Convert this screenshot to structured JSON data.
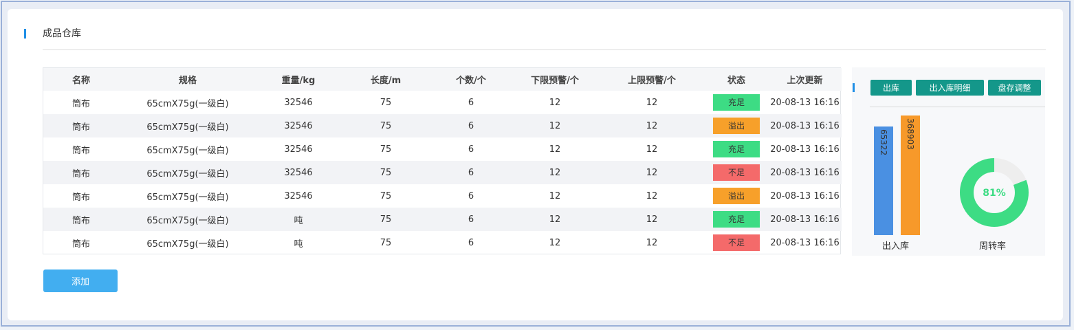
{
  "page": {
    "title": "成品仓库"
  },
  "table": {
    "headers": [
      "名称",
      "规格",
      "重量/kg",
      "长度/m",
      "个数/个",
      "下限预警/个",
      "上限预警/个",
      "状态",
      "上次更新"
    ],
    "rows": [
      [
        "筒布",
        "65cmX75g(一级白)",
        "32546",
        "75",
        "6",
        "12",
        "12",
        "充足",
        "20-08-13 16:16"
      ],
      [
        "筒布",
        "65cmX75g(一级白)",
        "32546",
        "75",
        "6",
        "12",
        "12",
        "溢出",
        "20-08-13 16:16"
      ],
      [
        "筒布",
        "65cmX75g(一级白)",
        "32546",
        "75",
        "6",
        "12",
        "12",
        "充足",
        "20-08-13 16:16"
      ],
      [
        "筒布",
        "65cmX75g(一级白)",
        "32546",
        "75",
        "6",
        "12",
        "12",
        "不足",
        "20-08-13 16:16"
      ],
      [
        "筒布",
        "65cmX75g(一级白)",
        "32546",
        "75",
        "6",
        "12",
        "12",
        "溢出",
        "20-08-13 16:16"
      ],
      [
        "筒布",
        "65cmX75g(一级白)",
        "吨",
        "75",
        "6",
        "12",
        "12",
        "充足",
        "20-08-13 16:16"
      ],
      [
        "筒布",
        "65cmX75g(一级白)",
        "吨",
        "75",
        "6",
        "12",
        "12",
        "不足",
        "20-08-13 16:16"
      ]
    ],
    "status_colors": {
      "充足": "#3ddc84",
      "溢出": "#f7a02a",
      "不足": "#f46a6a"
    }
  },
  "actions": {
    "add_label": "添加"
  },
  "side_panel": {
    "buttons": [
      "出库",
      "出入库明细",
      "盘存调整"
    ],
    "button_color": "#14978a"
  },
  "chart_data": [
    {
      "type": "bar",
      "categories": [
        "出入库"
      ],
      "series": [
        {
          "values": [
            65322
          ],
          "color": "#4a90e2"
        },
        {
          "values": [
            368903
          ],
          "color": "#f7992a"
        }
      ],
      "xlabel": "出入库"
    },
    {
      "type": "pie",
      "values": [
        81,
        19
      ],
      "center_label": "81%",
      "xlabel": "周转率",
      "colors": [
        "#3ddc84",
        "#eeeeee"
      ]
    }
  ]
}
